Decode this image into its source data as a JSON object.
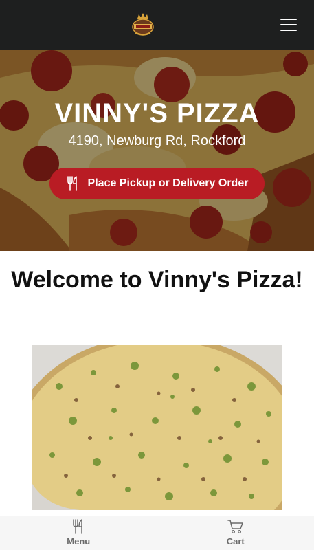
{
  "header": {
    "logo_icon": "vinnys-crown-logo",
    "menu_icon": "hamburger-icon"
  },
  "hero": {
    "title": "VINNY'S PIZZA",
    "address": "4190, Newburg Rd, Rockford",
    "order_button_label": "Place Pickup or Delivery Order",
    "order_button_icon": "fork-knife-icon",
    "accent_color": "#b91c24"
  },
  "main": {
    "welcome_heading": "Welcome to Vinny's Pizza!"
  },
  "bottom_nav": {
    "items": [
      {
        "label": "Menu",
        "icon": "fork-knife-icon"
      },
      {
        "label": "Cart",
        "icon": "cart-icon"
      }
    ]
  }
}
